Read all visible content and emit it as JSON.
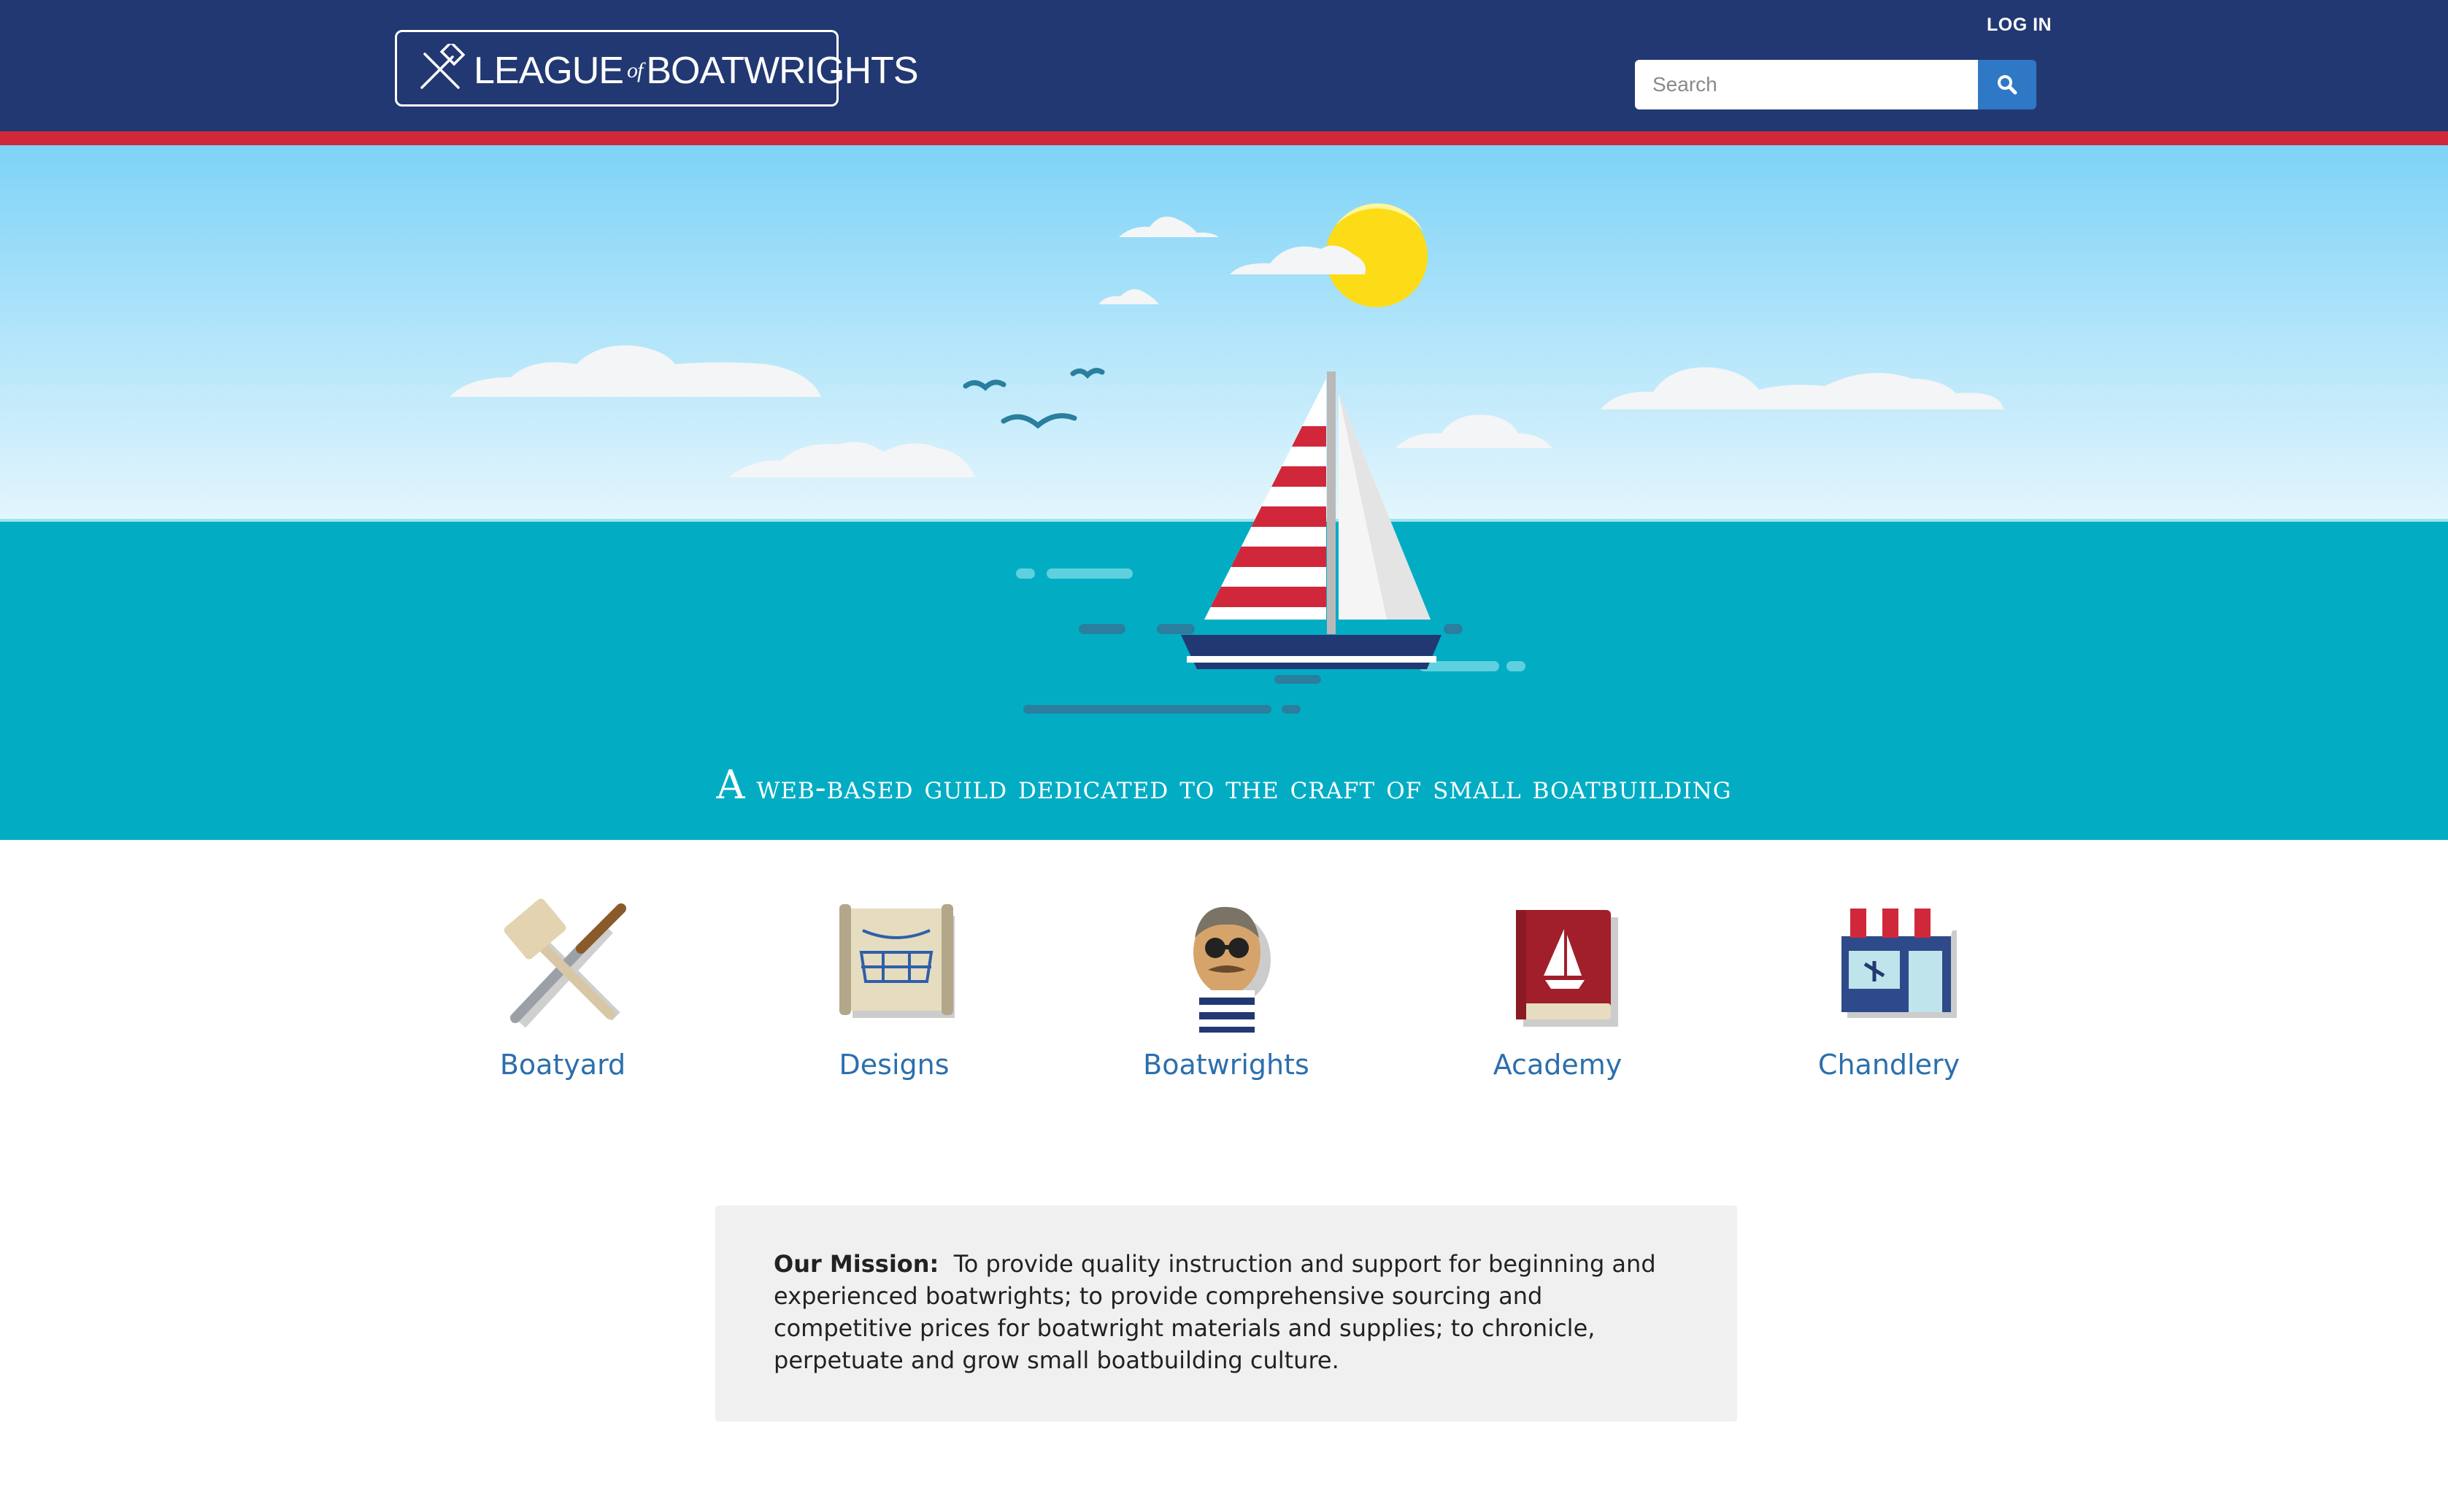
{
  "header": {
    "logo_text_main1": "LEAGUE",
    "logo_text_of": "of",
    "logo_text_main2": "BOATWRIGHTS",
    "login_label": "LOG IN",
    "search_placeholder": "Search"
  },
  "hero": {
    "tagline_first": "A",
    "tagline_rest": " web-based guild dedicated to the craft of small boatbuilding"
  },
  "categories": [
    {
      "label": "Boatyard",
      "icon": "mallet-chisel-icon"
    },
    {
      "label": "Designs",
      "icon": "blueprint-scroll-icon"
    },
    {
      "label": "Boatwrights",
      "icon": "sailor-avatar-icon"
    },
    {
      "label": "Academy",
      "icon": "book-icon"
    },
    {
      "label": "Chandlery",
      "icon": "shop-icon"
    }
  ],
  "mission": {
    "heading": "Our Mission:",
    "text": "To provide quality instruction and support for beginning and experienced boatwrights; to provide comprehensive sourcing and competitive prices for boatwright materials and supplies; to chronicle, perpetuate and grow small boatbuilding culture."
  },
  "colors": {
    "header_bg": "#223872",
    "accent_red": "#d0283a",
    "sea": "#02adc4",
    "link": "#2c6fad",
    "search_button": "#2f78c5"
  }
}
